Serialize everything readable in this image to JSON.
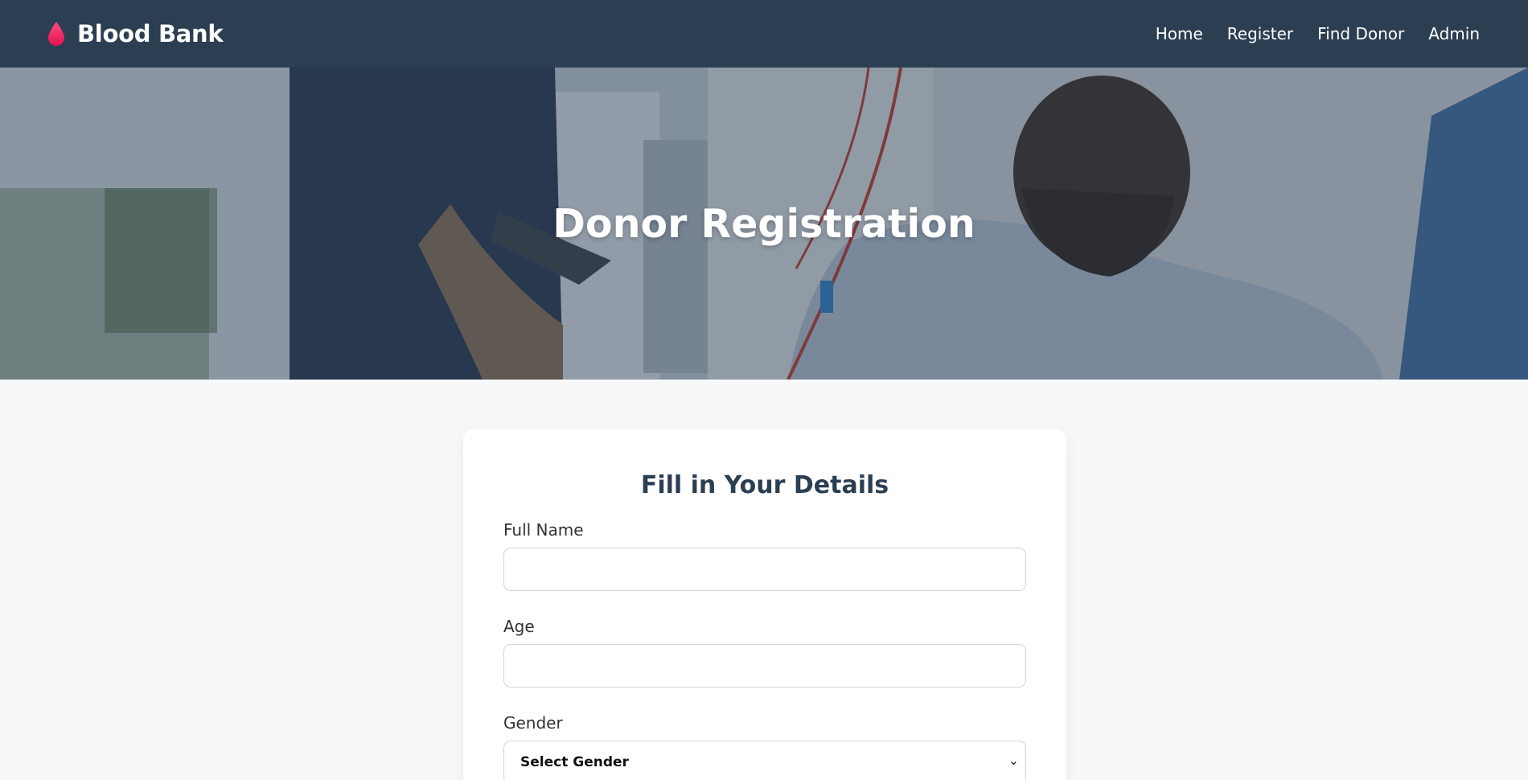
{
  "navbar": {
    "brand": "Blood Bank",
    "brand_icon": "blood-drop-icon",
    "brand_color": "#e8265e",
    "links": [
      "Home",
      "Register",
      "Find Donor",
      "Admin"
    ]
  },
  "hero": {
    "title": "Donor Registration"
  },
  "form": {
    "title": "Fill in Your Details",
    "fields": {
      "full_name": {
        "label": "Full Name",
        "value": ""
      },
      "age": {
        "label": "Age",
        "value": ""
      },
      "gender": {
        "label": "Gender",
        "selected": "Select Gender"
      }
    }
  },
  "colors": {
    "navbar_bg": "#2c3e52",
    "page_bg": "#f7f8fa",
    "heading": "#2c3e52"
  }
}
